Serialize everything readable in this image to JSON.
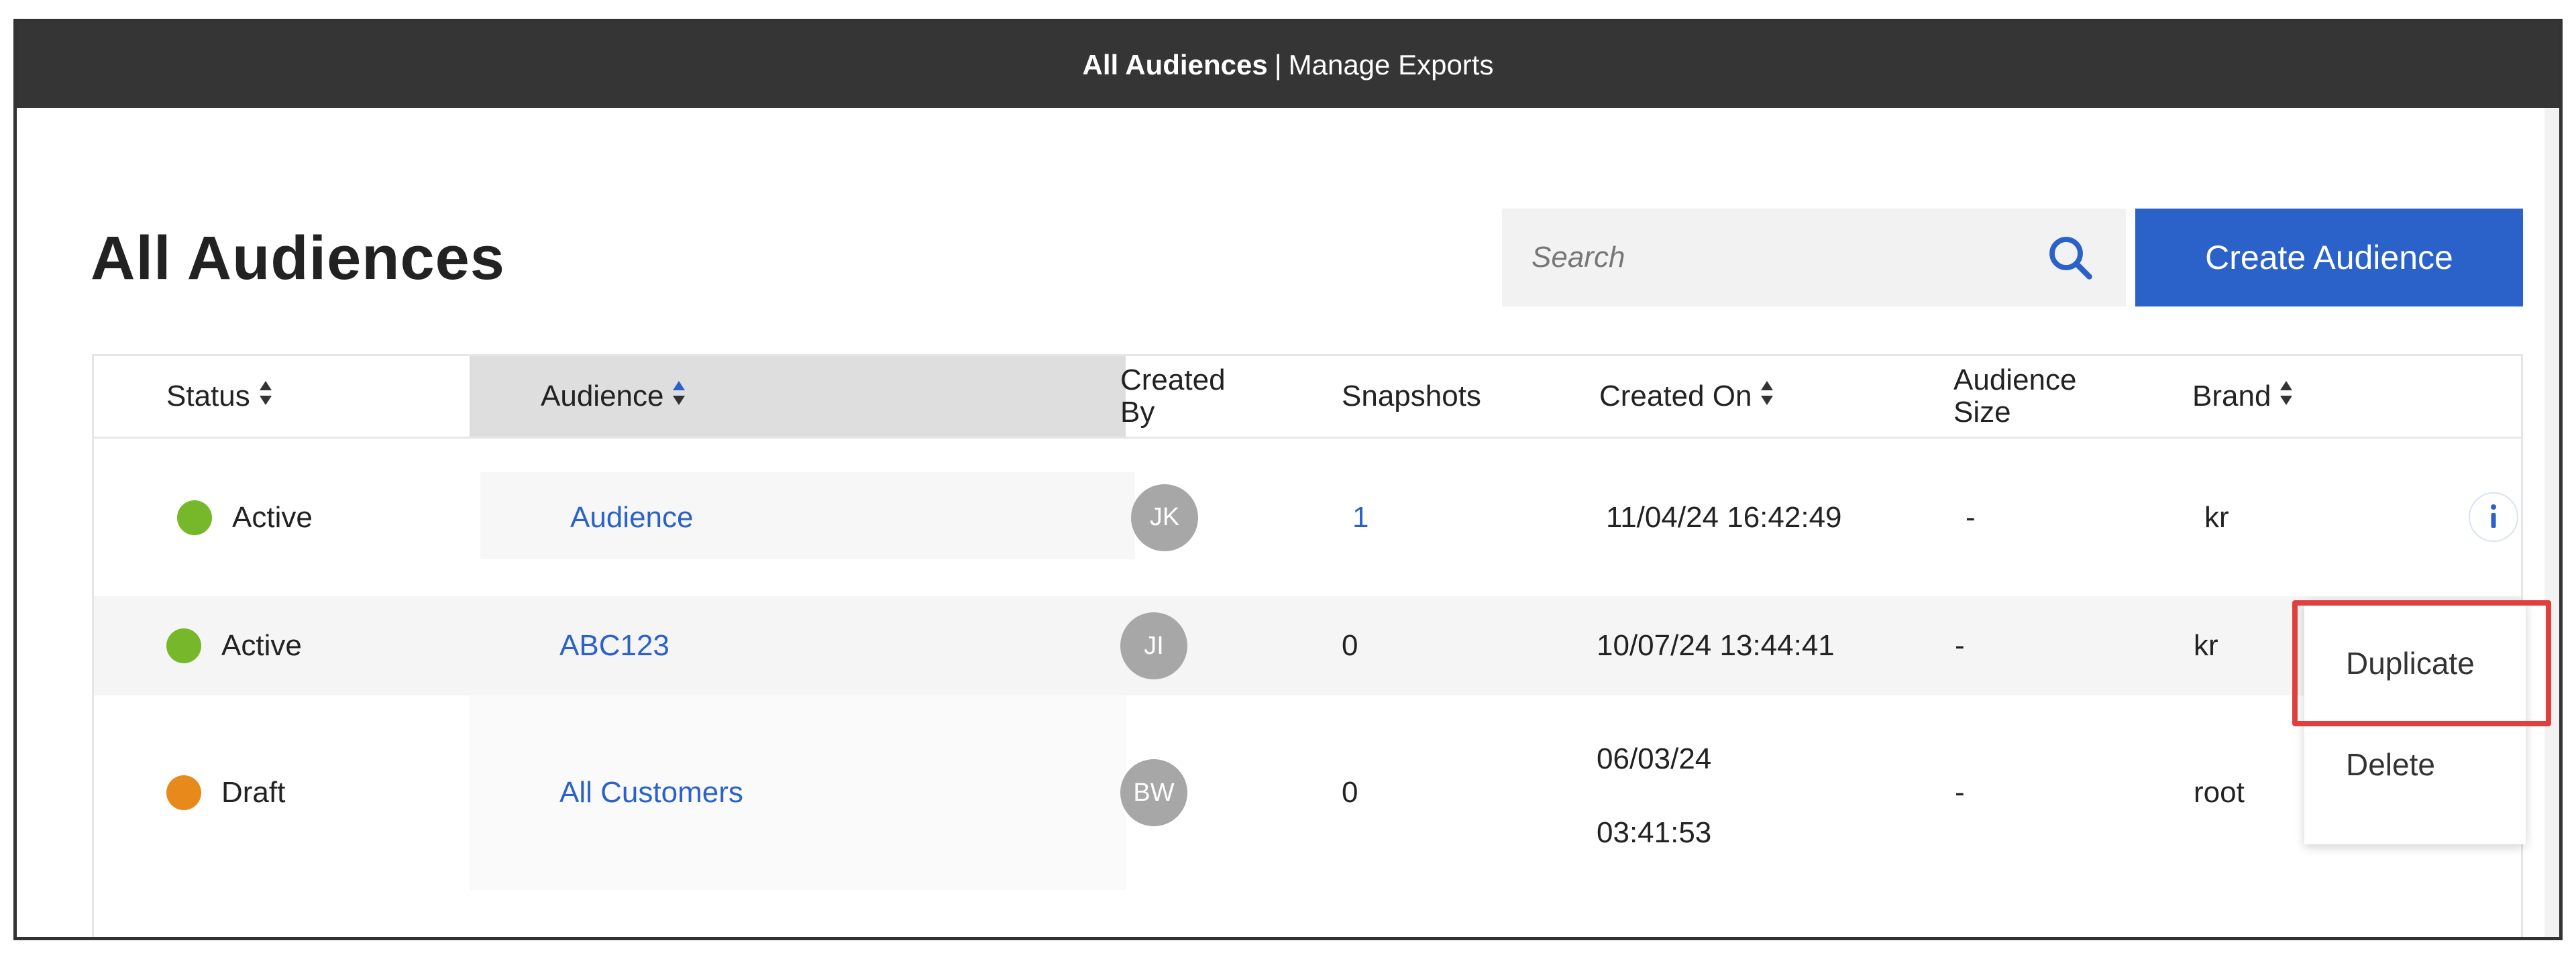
{
  "topbar": {
    "active_tab": "All Audiences",
    "separator": "|",
    "other_tab": "Manage Exports"
  },
  "page": {
    "title": "All Audiences"
  },
  "search": {
    "placeholder": "Search",
    "icon": "search-icon"
  },
  "create_button": {
    "label": "Create Audience"
  },
  "colors": {
    "topbar_bg": "#353535",
    "accent": "#2a62c9",
    "status_active": "#76b82a",
    "status_draft": "#e8891c",
    "highlight": "#e0403d"
  },
  "table": {
    "columns": [
      {
        "label": "Status",
        "sortable": true
      },
      {
        "label": "Audience",
        "sortable": true,
        "sorted": true
      },
      {
        "label": "Created By",
        "line1": "Created",
        "line2": "By",
        "sortable": false
      },
      {
        "label": "Snapshots",
        "sortable": false
      },
      {
        "label": "Created On",
        "sortable": true
      },
      {
        "label": "Audience Size",
        "line1": "Audience",
        "line2": "Size",
        "sortable": false
      },
      {
        "label": "Brand",
        "sortable": true
      }
    ],
    "rows": [
      {
        "status": "Active",
        "audience": "Audience",
        "created_by": "JK",
        "snapshots": "1",
        "created_on": "11/04/24 16:42:49",
        "size": "-",
        "brand": "kr"
      },
      {
        "status": "Active",
        "audience": "ABC123",
        "created_by": "JI",
        "snapshots": "0",
        "created_on": "10/07/24 13:44:41",
        "size": "-",
        "brand": "kr"
      },
      {
        "status": "Draft",
        "audience": "All Customers",
        "created_by": "BW",
        "snapshots": "0",
        "created_on_line1": "06/03/24",
        "created_on_line2": "03:41:53",
        "size": "-",
        "brand": "root"
      }
    ]
  },
  "context_menu": {
    "items": [
      {
        "label": "Duplicate",
        "highlighted": true
      },
      {
        "label": "Delete"
      }
    ]
  }
}
